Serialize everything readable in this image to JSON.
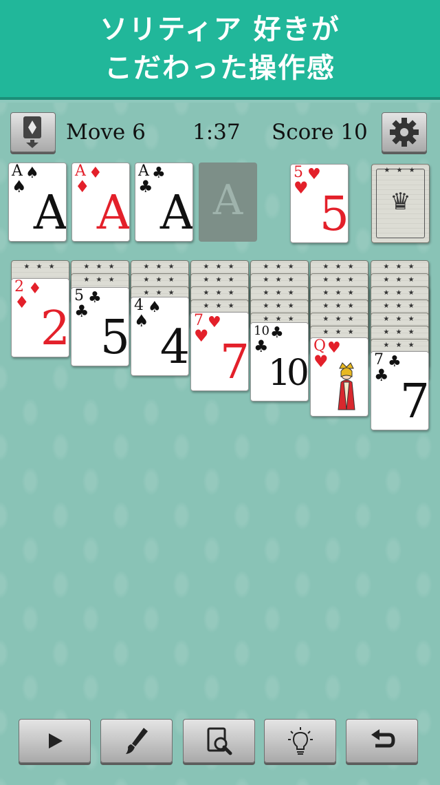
{
  "banner": {
    "line1": "ソリティア 好きが",
    "line2": "こだわった操作感"
  },
  "status": {
    "moves": "Move 6",
    "time": "1:37",
    "score": "Score 10"
  },
  "icons": {
    "deal_mode": "card-stack-arrow-icon",
    "settings": "gear-icon",
    "play": "play-icon",
    "theme": "paintbrush-icon",
    "search": "magnifier-card-icon",
    "hint": "lightbulb-icon",
    "undo": "undo-icon"
  },
  "foundations": [
    {
      "rank": "A",
      "suit": "♠",
      "color": "black"
    },
    {
      "rank": "A",
      "suit": "♦",
      "color": "red"
    },
    {
      "rank": "A",
      "suit": "♣",
      "color": "black"
    },
    {
      "rank": "A",
      "suit": "",
      "color": "empty"
    }
  ],
  "waste": {
    "rank": "5",
    "suit": "♥",
    "color": "red"
  },
  "tableau": [
    {
      "face_down": 1,
      "card": {
        "rank": "2",
        "suit": "♦",
        "color": "red"
      }
    },
    {
      "face_down": 2,
      "card": {
        "rank": "5",
        "suit": "♣",
        "color": "black"
      }
    },
    {
      "face_down": 3,
      "card": {
        "rank": "4",
        "suit": "♠",
        "color": "black"
      }
    },
    {
      "face_down": 4,
      "card": {
        "rank": "7",
        "suit": "♥",
        "color": "red"
      }
    },
    {
      "face_down": 5,
      "card": {
        "rank": "10",
        "suit": "♣",
        "color": "black"
      }
    },
    {
      "face_down": 6,
      "card": {
        "rank": "Q",
        "suit": "♥",
        "color": "red"
      }
    },
    {
      "face_down": 7,
      "card": {
        "rank": "7",
        "suit": "♣",
        "color": "black"
      }
    }
  ],
  "colors": {
    "banner": "#21b79a",
    "felt": "#89c3b6",
    "red_suit": "#e3202a",
    "black_suit": "#111111"
  }
}
